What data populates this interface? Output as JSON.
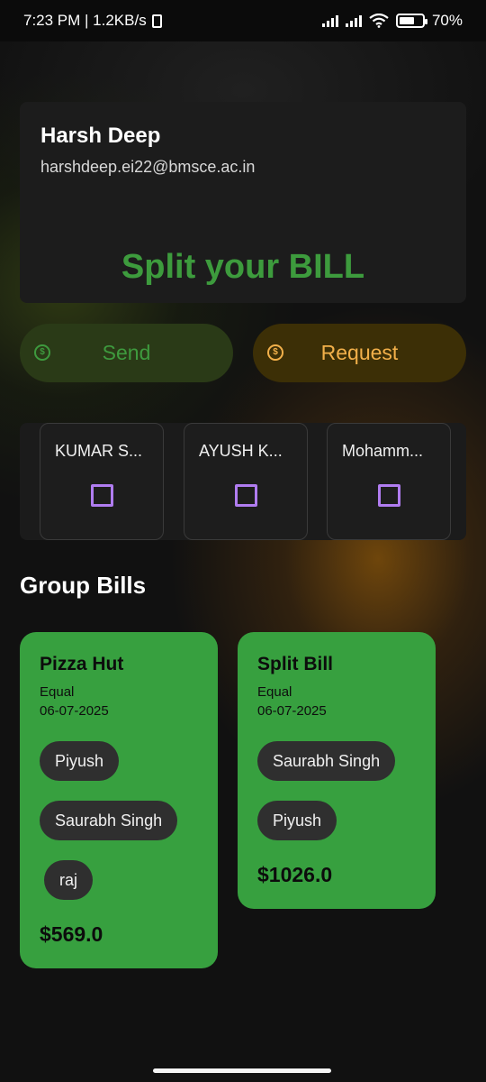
{
  "status_bar": {
    "time_speed": "7:23 PM | 1.2KB/s",
    "battery": "70%"
  },
  "profile": {
    "name": "Harsh Deep",
    "email": "harshdeep.ei22@bmsce.ac.in",
    "tagline": "Split your BILL"
  },
  "actions": {
    "send_label": "Send",
    "request_label": "Request",
    "send_icon": "dollar-coin-icon",
    "request_icon": "dollar-coin-icon"
  },
  "contacts": [
    {
      "name": "KUMAR S...",
      "checked": false
    },
    {
      "name": "AYUSH K...",
      "checked": false
    },
    {
      "name": "Mohamm...",
      "checked": false
    }
  ],
  "group_bills": {
    "title": "Group Bills",
    "bills": [
      {
        "title": "Pizza Hut",
        "split_type": "Equal",
        "date": "06-07-2025",
        "members": [
          "Piyush",
          "Saurabh Singh",
          "raj"
        ],
        "amount": "$569.0"
      },
      {
        "title": "Split Bill",
        "split_type": "Equal",
        "date": "06-07-2025",
        "members": [
          "Saurabh Singh",
          "Piyush"
        ],
        "amount": "$1026.0"
      }
    ]
  },
  "colors": {
    "accent_green": "#3d9b3d",
    "card_green": "#37a03f",
    "request_orange": "#f2b04a",
    "checkbox_purple": "#b07cf0"
  }
}
